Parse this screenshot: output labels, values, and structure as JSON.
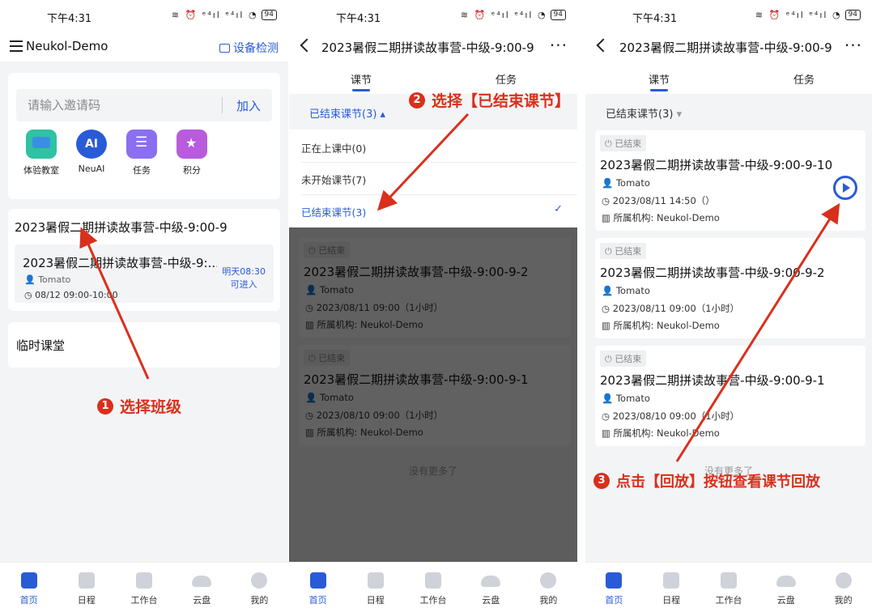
{
  "status": {
    "time": "下午4:31",
    "signal": "≋ ⏰ ᵉ⁴ıl ᵉ⁴ıl ◔",
    "battery": "94"
  },
  "p1": {
    "app_title": "Neukol-Demo",
    "device_check": "设备检测",
    "invite_placeholder": "请输入邀请码",
    "join_label": "加入",
    "apps": [
      "体验教室",
      "NeuAI",
      "任务",
      "积分"
    ],
    "ai_icon_text": "AI",
    "class_title": "2023暑假二期拼读故事营-中级-9:00-9",
    "lesson_title": "2023暑假二期拼读故事营-中级-9:...",
    "lesson_teacher": "Tomato",
    "lesson_time": "08/12 09:00-10:00",
    "lesson_next_line1": "明天08:30",
    "lesson_next_line2": "可进入",
    "temp_class": "临时课堂"
  },
  "p2": {
    "title": "2023暑假二期拼读故事营-中级-9:00-9",
    "tabs": [
      "课节",
      "任务"
    ],
    "filter": "已结束课节(3)",
    "dropdown": [
      "正在上课中(0)",
      "未开始课节(7)",
      "已结束课节(3)"
    ],
    "check": "✓"
  },
  "p3": {
    "title": "2023暑假二期拼读故事营-中级-9:00-9",
    "tabs": [
      "课节",
      "任务"
    ],
    "filter": "已结束课节(3)"
  },
  "lessons": [
    {
      "status": "已结束",
      "title": "2023暑假二期拼读故事营-中级-9:00-9-10",
      "teacher": "Tomato",
      "time": "2023/08/11 14:50（）",
      "org": "所属机构: Neukol-Demo"
    },
    {
      "status": "已结束",
      "title": "2023暑假二期拼读故事营-中级-9:00-9-2",
      "teacher": "Tomato",
      "time": "2023/08/11 09:00（1小时）",
      "org": "所属机构: Neukol-Demo"
    },
    {
      "status": "已结束",
      "title": "2023暑假二期拼读故事营-中级-9:00-9-1",
      "teacher": "Tomato",
      "time": "2023/08/10 09:00（1小时）",
      "org": "所属机构: Neukol-Demo"
    }
  ],
  "no_more": "没有更多了",
  "nav": [
    "首页",
    "日程",
    "工作台",
    "云盘",
    "我的"
  ],
  "annotations": {
    "a1": {
      "num": "1",
      "text": "选择班级"
    },
    "a2": {
      "num": "2",
      "text": "选择【已结束课节】"
    },
    "a3": {
      "num": "3",
      "text": "点击【回放】按钮查看课节回放"
    }
  },
  "colors": {
    "accent": "#2a5bd7",
    "annotation": "#d9301c"
  }
}
